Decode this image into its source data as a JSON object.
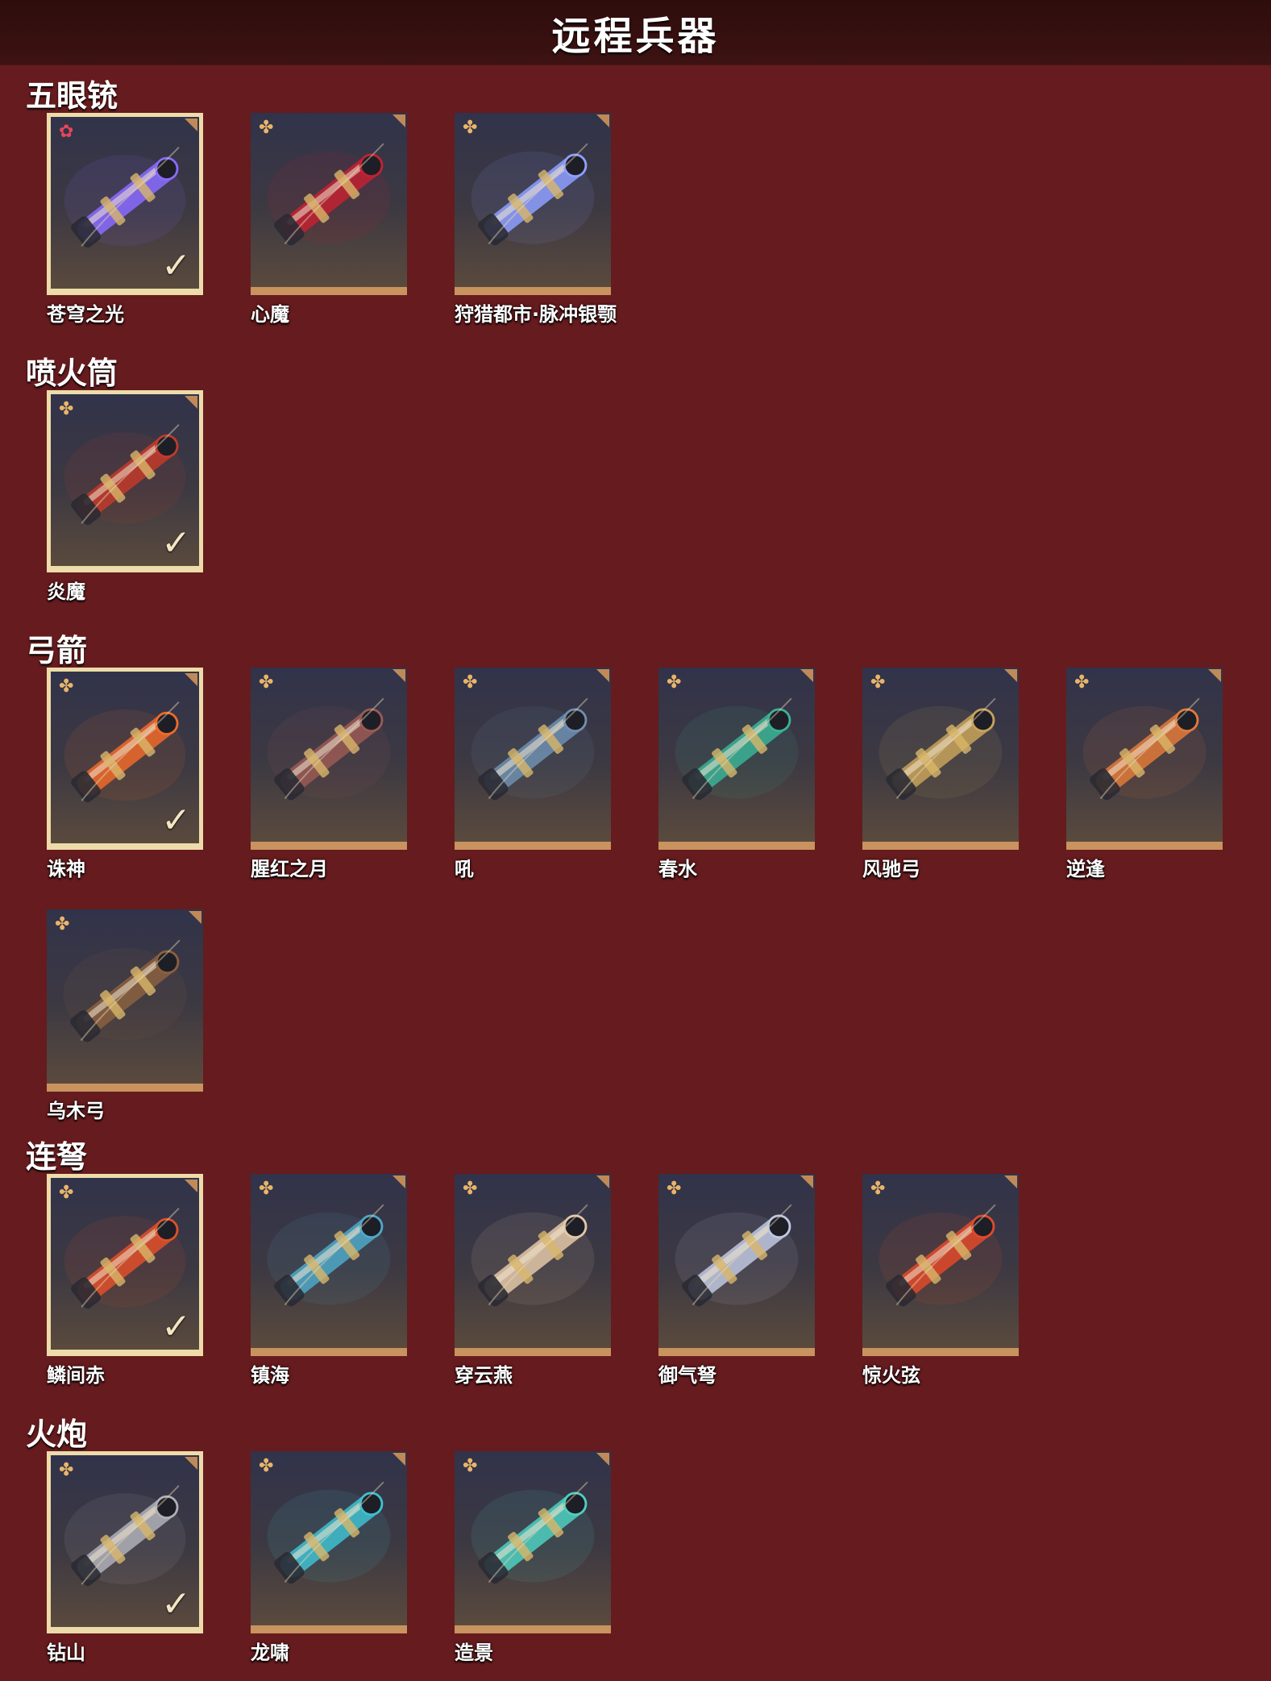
{
  "header": {
    "title": "远程兵器"
  },
  "colors": {
    "background": "#661b1e",
    "header": "#2e0d0d",
    "card_border": "#c8935f",
    "selected_border": "#eddcaa"
  },
  "sections": [
    {
      "title": "五眼铳",
      "items": [
        {
          "name": "苍穹之光",
          "rarity_icon": "red-flower-icon",
          "selected": true,
          "art": "#8a6cff"
        },
        {
          "name": "心魔",
          "rarity_icon": "gold-flower-icon",
          "selected": false,
          "art": "#c22231"
        },
        {
          "name": "狩猎都市·脉冲银颚",
          "rarity_icon": "gold-flower-icon",
          "selected": false,
          "art": "#8ea0ff"
        }
      ]
    },
    {
      "title": "喷火筒",
      "items": [
        {
          "name": "炎魔",
          "rarity_icon": "gold-flower-icon",
          "selected": true,
          "art": "#c23a2a"
        }
      ]
    },
    {
      "title": "弓箭",
      "items": [
        {
          "name": "诛神",
          "rarity_icon": "gold-flower-icon",
          "selected": true,
          "art": "#ef6a2a"
        },
        {
          "name": "腥红之月",
          "rarity_icon": "gold-flower-icon",
          "selected": false,
          "art": "#9a5a55"
        },
        {
          "name": "吼",
          "rarity_icon": "gold-flower-icon",
          "selected": false,
          "art": "#6f8fb0"
        },
        {
          "name": "春水",
          "rarity_icon": "gold-flower-icon",
          "selected": false,
          "art": "#3bb295"
        },
        {
          "name": "风驰弓",
          "rarity_icon": "gold-flower-icon",
          "selected": false,
          "art": "#c8a25a"
        },
        {
          "name": "逆逢",
          "rarity_icon": "gold-flower-icon",
          "selected": false,
          "art": "#e07a3a"
        },
        {
          "name": "乌木弓",
          "rarity_icon": "gold-flower-icon",
          "selected": false,
          "art": "#8a6040"
        }
      ]
    },
    {
      "title": "连弩",
      "items": [
        {
          "name": "鳞间赤",
          "rarity_icon": "gold-flower-icon",
          "selected": true,
          "art": "#e0502a"
        },
        {
          "name": "镇海",
          "rarity_icon": "gold-flower-icon",
          "selected": false,
          "art": "#4fa8c8"
        },
        {
          "name": "穿云燕",
          "rarity_icon": "gold-flower-icon",
          "selected": false,
          "art": "#e3c8a8"
        },
        {
          "name": "御气弩",
          "rarity_icon": "gold-flower-icon",
          "selected": false,
          "art": "#c0c8e0"
        },
        {
          "name": "惊火弦",
          "rarity_icon": "gold-flower-icon",
          "selected": false,
          "art": "#e04a2a"
        }
      ]
    },
    {
      "title": "火炮",
      "items": [
        {
          "name": "钻山",
          "rarity_icon": "gold-flower-icon",
          "selected": true,
          "art": "#b0b0b8"
        },
        {
          "name": "龙啸",
          "rarity_icon": "gold-flower-icon",
          "selected": false,
          "art": "#3fc0d0"
        },
        {
          "name": "造景",
          "rarity_icon": "gold-flower-icon",
          "selected": false,
          "art": "#4fcfc0"
        }
      ]
    }
  ]
}
